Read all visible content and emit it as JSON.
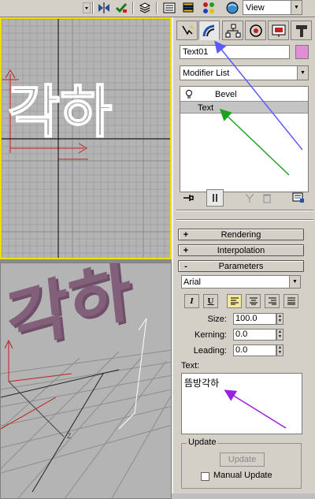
{
  "toolbar": {
    "view_label": "View",
    "icons": [
      "link-icon",
      "bind-icon",
      "layers-icon",
      "curve-editor-icon",
      "track-view-icon",
      "schematic-icon",
      "material-icon"
    ]
  },
  "command_panel": {
    "tabs": [
      "create-tab",
      "modify-tab",
      "hierarchy-tab",
      "motion-tab",
      "display-tab",
      "utilities-tab"
    ],
    "object_name": "Text01",
    "object_color": "#e08fd6",
    "modifier_list": "Modifier List",
    "stack": [
      {
        "label": "Bevel"
      },
      {
        "label": "Text"
      }
    ],
    "rollouts": {
      "rendering": {
        "sign": "+",
        "label": "Rendering"
      },
      "interpolation": {
        "sign": "+",
        "label": "Interpolation"
      },
      "parameters": {
        "sign": "-",
        "label": "Parameters"
      }
    },
    "font": "Arial",
    "format_buttons": {
      "italic": "I",
      "underline": "U"
    },
    "size_label": "Size:",
    "size_value": "100.0",
    "kerning_label": "Kerning:",
    "kerning_value": "0.0",
    "leading_label": "Leading:",
    "leading_value": "0.0",
    "text_label": "Text:",
    "text_value": "뜸방각하",
    "update_group": "Update",
    "update_button": "Update",
    "manual_update_label": "Manual Update",
    "manual_update_checked": false
  },
  "viewports": {
    "top_text": "각하",
    "persp_text": "각하"
  },
  "annotations": {
    "arrow_colors": [
      "#5a5aff",
      "#20a020",
      "#9a20e0"
    ]
  }
}
